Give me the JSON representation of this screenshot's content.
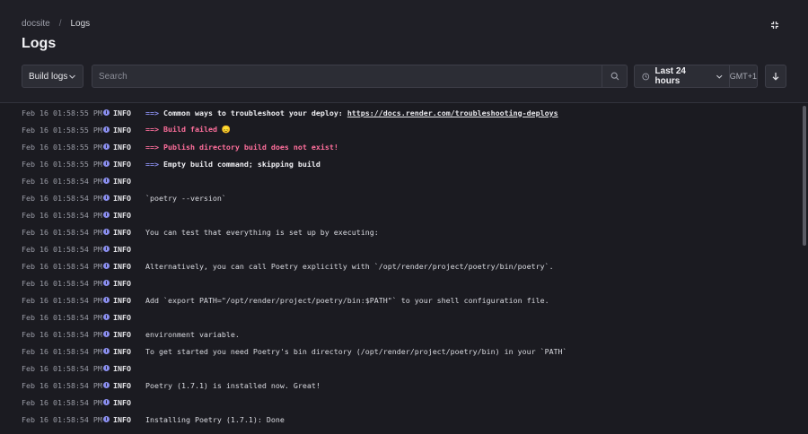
{
  "breadcrumb": {
    "parent": "docsite",
    "separator": "/",
    "current": "Logs"
  },
  "page_title": "Logs",
  "toolbar": {
    "log_type": "Build logs",
    "search_placeholder": "Search",
    "time_range": "Last 24 hours",
    "timezone": "GMT+1"
  },
  "icons": {
    "collapse": "collapse-icon",
    "search": "search-icon",
    "clock": "clock-icon",
    "chevron": "chevron-down-icon",
    "scroll_bottom": "arrow-down-icon",
    "info": "info-icon"
  },
  "colors": {
    "info_accent": "#8b8ff0",
    "error": "#ff6f9c",
    "background": "#1f1f26"
  },
  "logs": [
    {
      "time": "Feb 16 01:58:55 PM",
      "level": "INFO",
      "arrow": "==>",
      "text": "Common ways to troubleshoot your deploy: ",
      "link": "https://docs.render.com/troubleshooting-deploys",
      "style": "bold"
    },
    {
      "time": "Feb 16 01:58:55 PM",
      "level": "INFO",
      "arrow": "==>",
      "text": "Build failed 😞",
      "style": "error"
    },
    {
      "time": "Feb 16 01:58:55 PM",
      "level": "INFO",
      "arrow": "==>",
      "text": "Publish directory build does not exist!",
      "style": "error"
    },
    {
      "time": "Feb 16 01:58:55 PM",
      "level": "INFO",
      "arrow": "==>",
      "text": "Empty build command; skipping build",
      "style": "bold"
    },
    {
      "time": "Feb 16 01:58:54 PM",
      "level": "INFO",
      "text": ""
    },
    {
      "time": "Feb 16 01:58:54 PM",
      "level": "INFO",
      "text": "`poetry --version`"
    },
    {
      "time": "Feb 16 01:58:54 PM",
      "level": "INFO",
      "text": ""
    },
    {
      "time": "Feb 16 01:58:54 PM",
      "level": "INFO",
      "text": "You can test that everything is set up by executing:"
    },
    {
      "time": "Feb 16 01:58:54 PM",
      "level": "INFO",
      "text": ""
    },
    {
      "time": "Feb 16 01:58:54 PM",
      "level": "INFO",
      "text": "Alternatively, you can call Poetry explicitly with `/opt/render/project/poetry/bin/poetry`."
    },
    {
      "time": "Feb 16 01:58:54 PM",
      "level": "INFO",
      "text": ""
    },
    {
      "time": "Feb 16 01:58:54 PM",
      "level": "INFO",
      "text": "Add `export PATH=\"/opt/render/project/poetry/bin:$PATH\"` to your shell configuration file."
    },
    {
      "time": "Feb 16 01:58:54 PM",
      "level": "INFO",
      "text": ""
    },
    {
      "time": "Feb 16 01:58:54 PM",
      "level": "INFO",
      "text": "environment variable."
    },
    {
      "time": "Feb 16 01:58:54 PM",
      "level": "INFO",
      "text": "To get started you need Poetry's bin directory (/opt/render/project/poetry/bin) in your `PATH`"
    },
    {
      "time": "Feb 16 01:58:54 PM",
      "level": "INFO",
      "text": ""
    },
    {
      "time": "Feb 16 01:58:54 PM",
      "level": "INFO",
      "text": "Poetry (1.7.1) is installed now. Great!"
    },
    {
      "time": "Feb 16 01:58:54 PM",
      "level": "INFO",
      "text": ""
    },
    {
      "time": "Feb 16 01:58:54 PM",
      "level": "INFO",
      "text": "Installing Poetry (1.7.1): Done"
    }
  ]
}
